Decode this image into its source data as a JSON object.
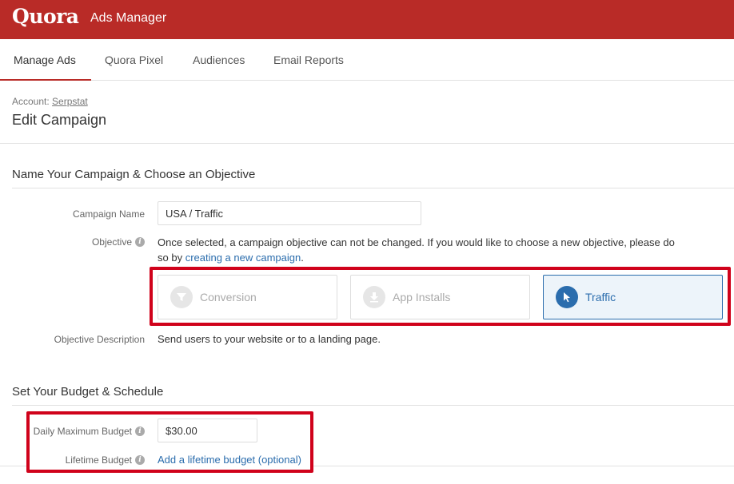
{
  "header": {
    "logo": "Quora",
    "app_title": "Ads Manager"
  },
  "tabs": [
    {
      "label": "Manage Ads",
      "active": true
    },
    {
      "label": "Quora Pixel",
      "active": false
    },
    {
      "label": "Audiences",
      "active": false
    },
    {
      "label": "Email Reports",
      "active": false
    }
  ],
  "account": {
    "prefix": "Account:",
    "name": "Serpstat"
  },
  "page_title": "Edit Campaign",
  "section1": {
    "title": "Name Your Campaign & Choose an Objective",
    "campaign_name_label": "Campaign Name",
    "campaign_name_value": "USA / Traffic",
    "objective_label": "Objective",
    "objective_help_before": "Once selected, a campaign objective can not be changed. If you would like to choose a new objective, please do so by ",
    "objective_help_link": "creating a new campaign",
    "objective_help_after": ".",
    "objectives": [
      {
        "label": "Conversion",
        "icon": "filter-icon",
        "selected": false
      },
      {
        "label": "App Installs",
        "icon": "download-icon",
        "selected": false
      },
      {
        "label": "Traffic",
        "icon": "cursor-icon",
        "selected": true
      }
    ],
    "description_label": "Objective Description",
    "description_value": "Send users to your website or to a landing page."
  },
  "section2": {
    "title": "Set Your Budget & Schedule",
    "daily_budget_label": "Daily Maximum Budget",
    "daily_budget_value": "$30.00",
    "lifetime_budget_label": "Lifetime Budget",
    "lifetime_budget_link": "Add a lifetime budget (optional)"
  },
  "colors": {
    "brand_red": "#b92b27",
    "link_blue": "#2b6dad",
    "highlight_red": "#d0021b",
    "selected_bg": "#edf4fa"
  }
}
